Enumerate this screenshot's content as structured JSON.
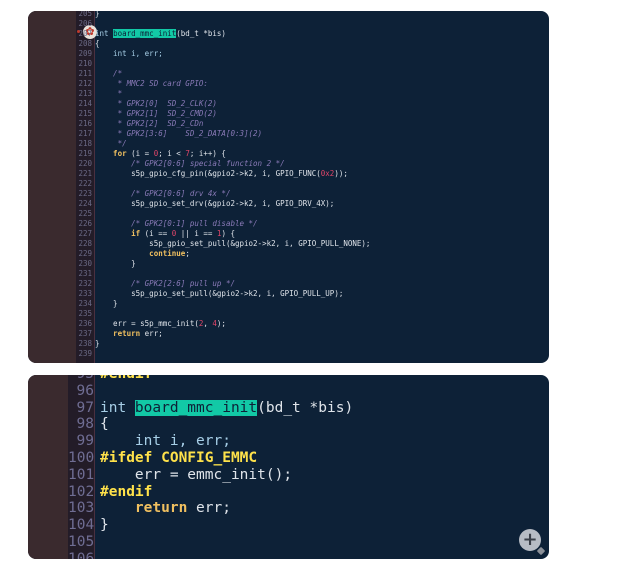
{
  "top_panel": {
    "lines": [
      {
        "n": "205",
        "segs": [
          {
            "t": "}",
            "c": ""
          }
        ]
      },
      {
        "n": "206",
        "segs": []
      },
      {
        "n": "207",
        "segs": [
          {
            "t": "int ",
            "c": "typ"
          },
          {
            "t": "board_mmc_init",
            "c": "hl"
          },
          {
            "t": "(bd_t *bis)",
            "c": ""
          }
        ]
      },
      {
        "n": "208",
        "segs": [
          {
            "t": "{",
            "c": ""
          }
        ]
      },
      {
        "n": "209",
        "segs": [
          {
            "t": "    int i, err;",
            "c": "typ"
          }
        ]
      },
      {
        "n": "210",
        "segs": []
      },
      {
        "n": "211",
        "segs": [
          {
            "t": "    /*",
            "c": "cm"
          }
        ]
      },
      {
        "n": "212",
        "segs": [
          {
            "t": "     * MMC2 SD card GPIO:",
            "c": "cm"
          }
        ]
      },
      {
        "n": "213",
        "segs": [
          {
            "t": "     *",
            "c": "cm"
          }
        ]
      },
      {
        "n": "214",
        "segs": [
          {
            "t": "     * GPK2[0]  SD_2_CLK(2)",
            "c": "cm"
          }
        ]
      },
      {
        "n": "215",
        "segs": [
          {
            "t": "     * GPK2[1]  SD_2_CMD(2)",
            "c": "cm"
          }
        ]
      },
      {
        "n": "216",
        "segs": [
          {
            "t": "     * GPK2[2]  SD_2_CDn",
            "c": "cm"
          }
        ]
      },
      {
        "n": "217",
        "segs": [
          {
            "t": "     * GPK2[3:6]    SD_2_DATA[0:3](2)",
            "c": "cm"
          }
        ]
      },
      {
        "n": "218",
        "segs": [
          {
            "t": "     */",
            "c": "cm"
          }
        ]
      },
      {
        "n": "219",
        "segs": [
          {
            "t": "    for",
            "c": "kw"
          },
          {
            "t": " (i = ",
            "c": ""
          },
          {
            "t": "0",
            "c": "num"
          },
          {
            "t": "; i < ",
            "c": ""
          },
          {
            "t": "7",
            "c": "num"
          },
          {
            "t": "; i++) {",
            "c": ""
          }
        ]
      },
      {
        "n": "220",
        "segs": [
          {
            "t": "        /* GPK2[0:6] special function 2 */",
            "c": "cm"
          }
        ]
      },
      {
        "n": "221",
        "segs": [
          {
            "t": "        s5p_gpio_cfg_pin(&gpio2->k2, i, GPIO_FUNC(",
            "c": ""
          },
          {
            "t": "0x2",
            "c": "num"
          },
          {
            "t": "));",
            "c": ""
          }
        ]
      },
      {
        "n": "222",
        "segs": []
      },
      {
        "n": "223",
        "segs": [
          {
            "t": "        /* GPK2[0:6] drv 4x */",
            "c": "cm"
          }
        ]
      },
      {
        "n": "224",
        "segs": [
          {
            "t": "        s5p_gpio_set_drv(&gpio2->k2, i, GPIO_DRV_4X);",
            "c": ""
          }
        ]
      },
      {
        "n": "225",
        "segs": []
      },
      {
        "n": "226",
        "segs": [
          {
            "t": "        /* GPK2[0:1] pull disable */",
            "c": "cm"
          }
        ]
      },
      {
        "n": "227",
        "segs": [
          {
            "t": "        if",
            "c": "kw"
          },
          {
            "t": " (i == ",
            "c": ""
          },
          {
            "t": "0",
            "c": "num"
          },
          {
            "t": " || i == ",
            "c": ""
          },
          {
            "t": "1",
            "c": "num"
          },
          {
            "t": ") {",
            "c": ""
          }
        ]
      },
      {
        "n": "228",
        "segs": [
          {
            "t": "            s5p_gpio_set_pull(&gpio2->k2, i, GPIO_PULL_NONE);",
            "c": ""
          }
        ]
      },
      {
        "n": "229",
        "segs": [
          {
            "t": "            continue",
            "c": "kw"
          },
          {
            "t": ";",
            "c": ""
          }
        ]
      },
      {
        "n": "230",
        "segs": [
          {
            "t": "        }",
            "c": ""
          }
        ]
      },
      {
        "n": "231",
        "segs": []
      },
      {
        "n": "232",
        "segs": [
          {
            "t": "        /* GPK2[2:6] pull up */",
            "c": "cm"
          }
        ]
      },
      {
        "n": "233",
        "segs": [
          {
            "t": "        s5p_gpio_set_pull(&gpio2->k2, i, GPIO_PULL_UP);",
            "c": ""
          }
        ]
      },
      {
        "n": "234",
        "segs": [
          {
            "t": "    }",
            "c": ""
          }
        ]
      },
      {
        "n": "235",
        "segs": []
      },
      {
        "n": "236",
        "segs": [
          {
            "t": "    err = s5p_mmc_init(",
            "c": ""
          },
          {
            "t": "2",
            "c": "num"
          },
          {
            "t": ", ",
            "c": ""
          },
          {
            "t": "4",
            "c": "num"
          },
          {
            "t": ");",
            "c": ""
          }
        ]
      },
      {
        "n": "237",
        "segs": [
          {
            "t": "    return",
            "c": "kw"
          },
          {
            "t": " err;",
            "c": ""
          }
        ]
      },
      {
        "n": "238",
        "segs": [
          {
            "t": "}",
            "c": ""
          }
        ]
      },
      {
        "n": "239",
        "segs": []
      }
    ]
  },
  "bottom_panel": {
    "lines": [
      {
        "n": "95",
        "segs": [
          {
            "t": "#endif",
            "c": "pp"
          }
        ]
      },
      {
        "n": "96",
        "segs": []
      },
      {
        "n": "97",
        "segs": [
          {
            "t": "int ",
            "c": "typ"
          },
          {
            "t": "board_mmc_init",
            "c": "hl"
          },
          {
            "t": "(bd_t *bis)",
            "c": ""
          }
        ]
      },
      {
        "n": "98",
        "segs": [
          {
            "t": "{",
            "c": ""
          }
        ]
      },
      {
        "n": "99",
        "segs": [
          {
            "t": "    int i, err;",
            "c": "typ"
          }
        ]
      },
      {
        "n": "100",
        "segs": [
          {
            "t": "#ifdef CONFIG_EMMC",
            "c": "pp"
          }
        ]
      },
      {
        "n": "101",
        "segs": [
          {
            "t": "    err = emmc_init();",
            "c": ""
          }
        ]
      },
      {
        "n": "102",
        "segs": [
          {
            "t": "#endif",
            "c": "pp"
          }
        ]
      },
      {
        "n": "103",
        "segs": [
          {
            "t": "    return",
            "c": "kw"
          },
          {
            "t": " err;",
            "c": ""
          }
        ]
      },
      {
        "n": "104",
        "segs": [
          {
            "t": "}",
            "c": ""
          }
        ]
      },
      {
        "n": "105",
        "segs": []
      },
      {
        "n": "106",
        "segs": []
      }
    ]
  },
  "icons": {
    "settings": "gear-icon",
    "zoom": "zoom-in-icon"
  },
  "colors": {
    "background": "#0d2137",
    "highlight": "#12c9a6",
    "keyword": "#f0c060",
    "comment": "#8a7ab8",
    "number": "#e0466a",
    "preprocessor": "#ffe24a"
  }
}
